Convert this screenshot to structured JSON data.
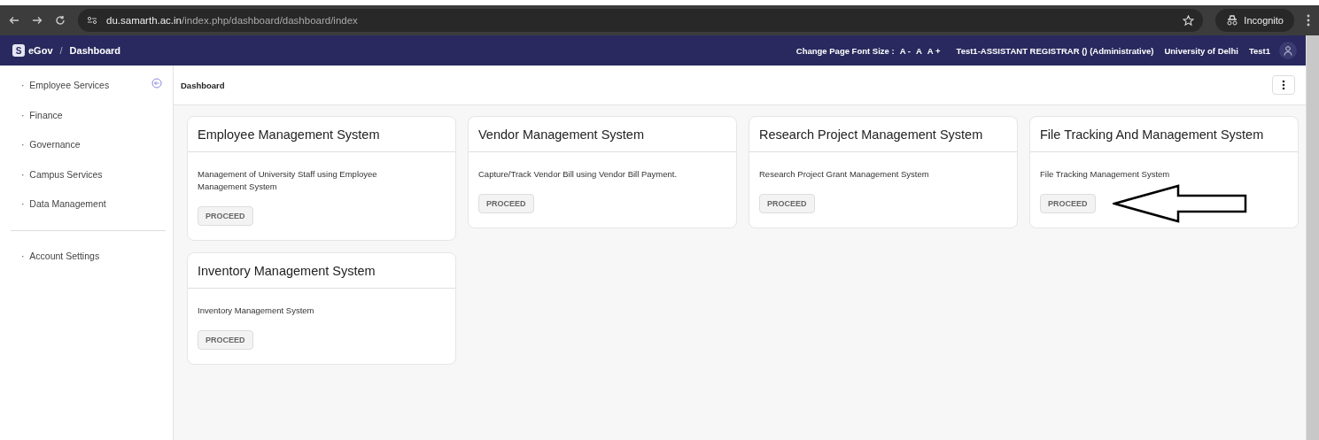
{
  "browser": {
    "url_host": "du.samarth.ac.in",
    "url_path": "/index.php/dashboard/dashboard/index",
    "profile": "Incognito"
  },
  "header": {
    "logo_letter": "S",
    "brand": "eGov",
    "separator": "/",
    "crumb": "Dashboard",
    "font_label": "Change Page Font Size :",
    "font_buttons": [
      "A -",
      "A",
      "A +"
    ],
    "role": "Test1-ASSISTANT REGISTRAR () (Administrative)",
    "university": "University of Delhi",
    "user": "Test1"
  },
  "sidebar": {
    "items": [
      {
        "label": "Employee Services",
        "bullet": "·"
      },
      {
        "label": "Finance",
        "bullet": "·"
      },
      {
        "label": "Governance",
        "bullet": "·"
      },
      {
        "label": "Campus Services",
        "bullet": "·"
      },
      {
        "label": "Data Management",
        "bullet": "·"
      }
    ],
    "bottom_items": [
      {
        "label": "Account Settings",
        "bullet": "·"
      }
    ]
  },
  "page_title": "Dashboard",
  "cards": [
    {
      "title": "Employee Management System",
      "description": "Management of University Staff using Employee Management System",
      "button": "PROCEED",
      "pointed": false
    },
    {
      "title": "Vendor Management System",
      "description": "Capture/Track Vendor Bill using Vendor Bill Payment.",
      "button": "PROCEED",
      "pointed": false
    },
    {
      "title": "Research Project Management System",
      "description": "Research Project Grant Management System",
      "button": "PROCEED",
      "pointed": false
    },
    {
      "title": "File Tracking And Management System",
      "description": "File Tracking Management System",
      "button": "PROCEED",
      "pointed": true
    },
    {
      "title": "Inventory Management System",
      "description": "Inventory Management System",
      "button": "PROCEED",
      "pointed": false
    }
  ]
}
